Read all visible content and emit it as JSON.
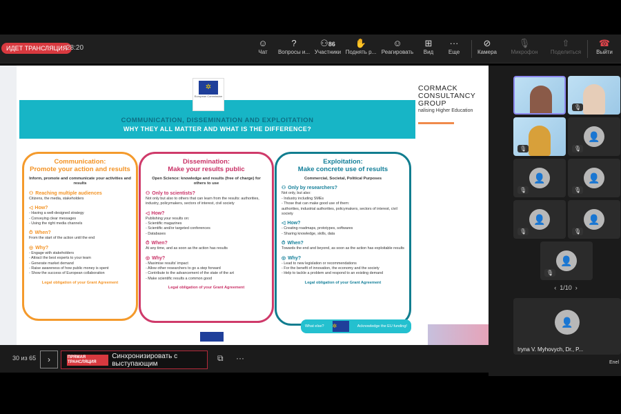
{
  "topbar": {
    "live": "ИДЕТ ТРАНСЛЯЦИЯ",
    "timer": "28:20",
    "participants_count": "86",
    "buttons": [
      "Чат",
      "Вопросы и...",
      "Участники",
      "Поднять р...",
      "Реагировать",
      "Вид",
      "Еще",
      "Камера",
      "Микрофон",
      "Поделиться",
      "Выйти"
    ]
  },
  "slide": {
    "title": "COMMUNICATION, DISSEMINATION AND EXPLOITATION",
    "subtitle": "WHY THEY ALL MATTER AND WHAT IS THE DIFFERENCE?",
    "ec_label": "European Commission",
    "logo": [
      "CORMACK",
      "CONSULTANCY",
      "GROUP"
    ],
    "logo_tagline": "nalising Higher Education",
    "cards": [
      {
        "title": "Communication:",
        "title2": "Promote your action and results",
        "sub": "Inform, promote and communicate your activities and results",
        "s1": "Reaching multiple audiences",
        "s1_text": "Citizens, the media, stakeholders",
        "how": "How?",
        "how_text": "- Having a well-designed strategy\n- Conveying clear messages\n- Using the right media channels",
        "when": "When?",
        "when_text": "From the start of the action until the end",
        "why": "Why?",
        "why_text": "- Engage with stakeholders\n- Attract the best experts to your team\n- Generate market demand\n- Raise awareness of how public money is spent\n- Show the success of European collaboration",
        "legal": "Legal obligation of your Grant Agreement"
      },
      {
        "title": "Dissemination:",
        "title2": "Make your results public",
        "sub": "Open Science: knowledge and results (free of charge) for others to use",
        "s1": "Only to scientists?",
        "s1_text": "Not only but also to others that can learn from the results: authorities, industry, policymakers, sectors of interest, civil society",
        "how": "How?",
        "how_text": "Publishing your results on:\n- Scientific magazines\n- Scientific and/or targeted conferences\n- Databases",
        "when": "When?",
        "when_text": "At any time, and as soon as the action has results",
        "why": "Why?",
        "why_text": "- Maximise results' impact\n- Allow other researchers to go a step forward\n- Contribute to the advancement of the state of the art\n- Make scientific results a common good",
        "legal": "Legal obligation of your Grant Agreement"
      },
      {
        "title": "Exploitation:",
        "title2": "Make concrete use of results",
        "sub": "Commercial, Societal, Political Purposes",
        "s1": "Only by researchers?",
        "s1_text": "Not only, but also:\n- Industry including SMEs\n- Those that can make good use of them:\n  authorities, industrial authorities, policymakers, sectors of interest, civil society",
        "how": "How?",
        "how_text": "- Creating roadmaps, prototypes, softwares\n- Sharing knowledge, skills, data",
        "when": "When?",
        "when_text": "Towards the end and beyond, as soon as the action has exploitable results",
        "why": "Why?",
        "why_text": "- Lead to new legislation or recommendations\n- For the benefit of innovation, the economy and the society\n- Help to tackle a problem and respond to an existing demand",
        "legal": "Legal obligation of your Grant Agreement"
      }
    ],
    "what_else": "What else?",
    "acknowledge": "Acknowledge the EU funding!"
  },
  "bottombar": {
    "page": "30 из 65",
    "live_badge": "ПРЯМАЯ ТРАНСЛЯЦИЯ",
    "sync": "Синхронизировать с выступающим"
  },
  "participants": {
    "pager": "1/10",
    "speaker_name": "Iryna V. Myhovych, Dr., P...",
    "next_name": "Enel"
  }
}
